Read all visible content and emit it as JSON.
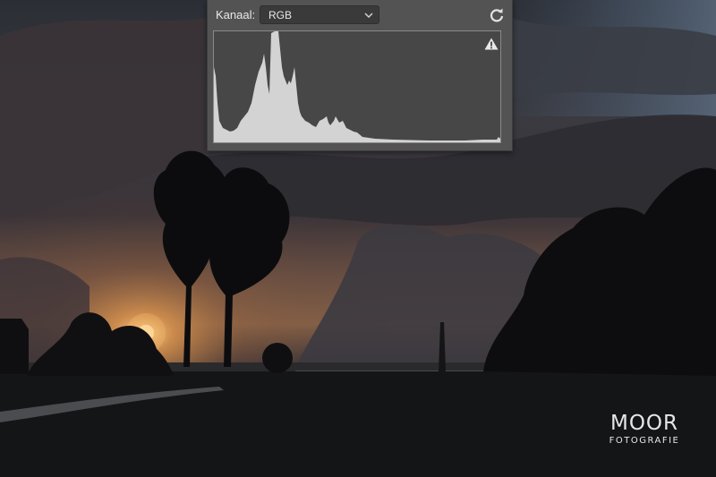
{
  "histogram_panel": {
    "channel_label": "Kanaal:",
    "channel_value": "RGB",
    "refresh_icon": "refresh-icon",
    "warning_icon": "warning-icon",
    "dropdown_icon": "chevron-down-icon"
  },
  "watermark": {
    "main": "MOOR",
    "sub": "FOTOGRAFIE"
  },
  "colors": {
    "panel_bg": "#535353",
    "histogram_fill": "#cfcfcf",
    "histogram_bg": "#474747"
  }
}
